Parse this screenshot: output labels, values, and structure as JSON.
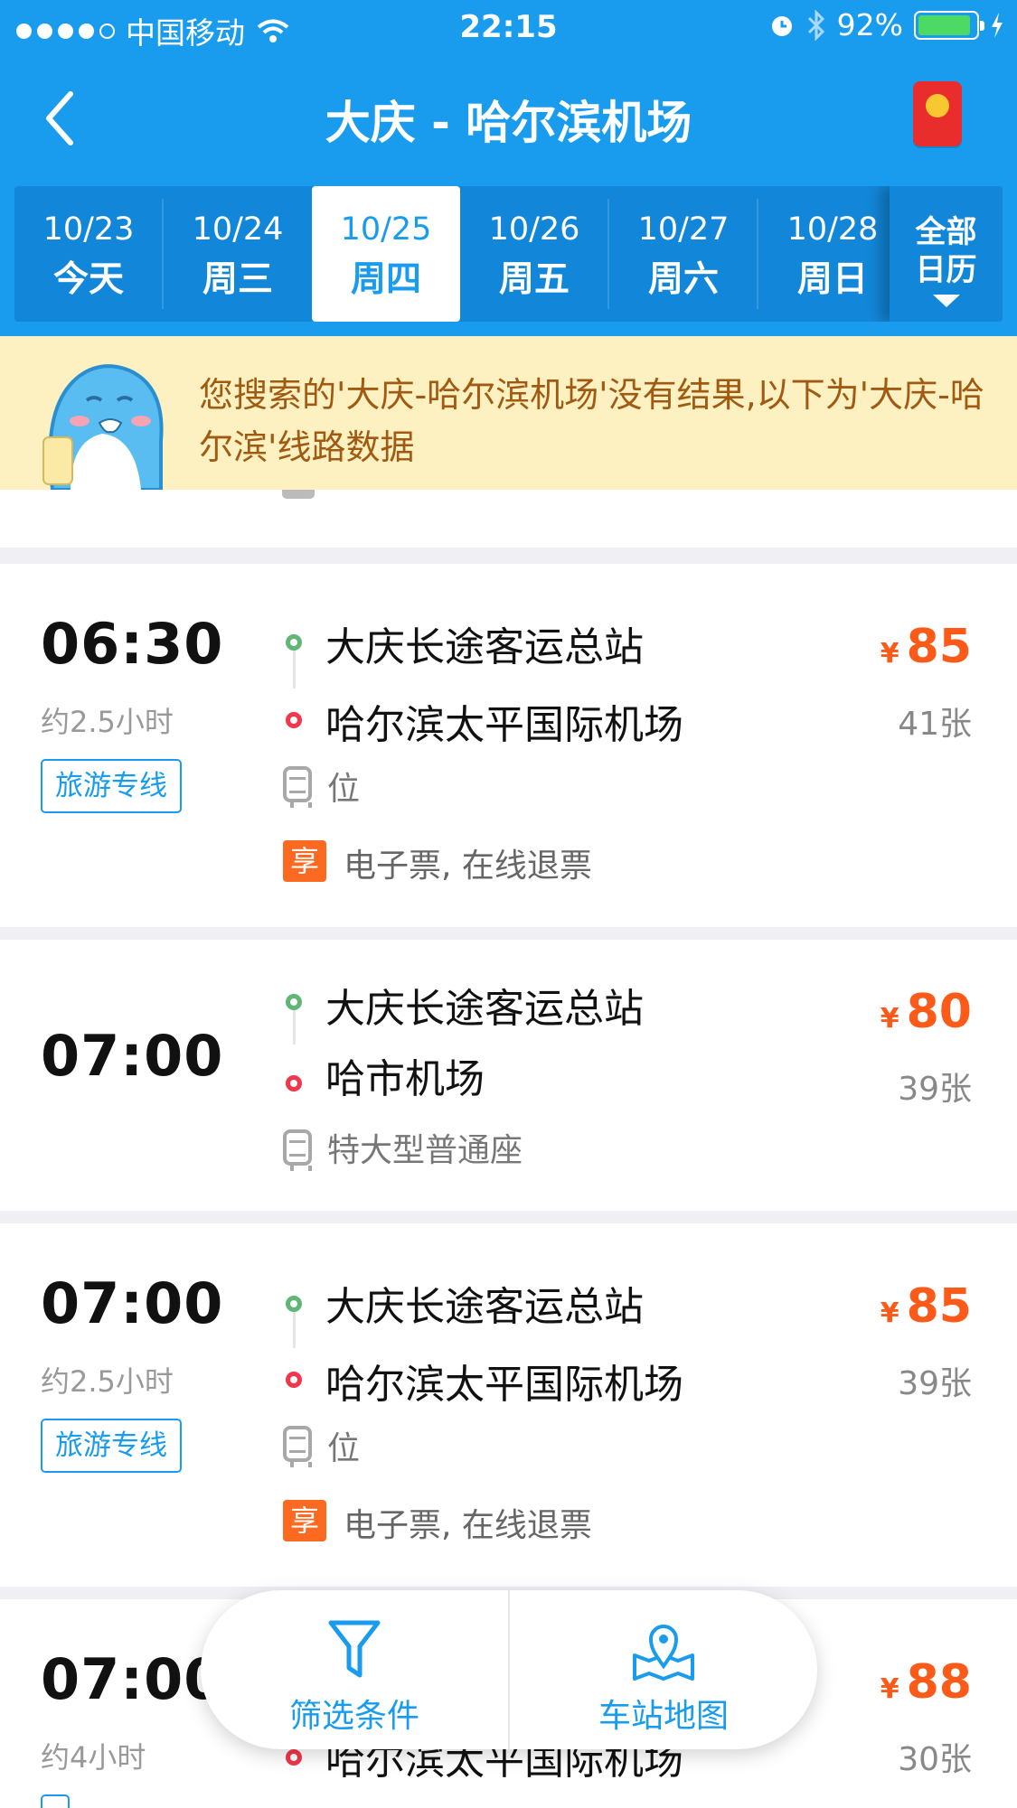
{
  "status_bar": {
    "carrier": "中国移动",
    "time": "22:15",
    "battery": "92%"
  },
  "nav": {
    "title": "大庆 - 哈尔滨机场"
  },
  "dates": [
    {
      "date": "10/23",
      "week": "今天"
    },
    {
      "date": "10/24",
      "week": "周三"
    },
    {
      "date": "10/25",
      "week": "周四"
    },
    {
      "date": "10/26",
      "week": "周五"
    },
    {
      "date": "10/27",
      "week": "周六"
    },
    {
      "date": "10/28",
      "week": "周日"
    }
  ],
  "calendar_button": {
    "line1": "全部",
    "line2": "日历"
  },
  "notice": "您搜索的'大庆-哈尔滨机场'没有结果,以下为'大庆-哈尔滨'线路数据",
  "trips": [
    {
      "time": "06:30",
      "duration": "约2.5小时",
      "tag": "旅游专线",
      "from": "大庆长途客运总站",
      "to": "哈尔滨太平国际机场",
      "seat": "位",
      "perk_badge": "享",
      "perks": "电子票, 在线退票",
      "currency": "¥",
      "price": "85",
      "tickets": "41张"
    },
    {
      "time": "07:00",
      "from": "大庆长途客运总站",
      "to": "哈市机场",
      "seat": "特大型普通座",
      "currency": "¥",
      "price": "80",
      "tickets": "39张"
    },
    {
      "time": "07:00",
      "duration": "约2.5小时",
      "tag": "旅游专线",
      "from": "大庆长途客运总站",
      "to": "哈尔滨太平国际机场",
      "seat": "位",
      "perk_badge": "享",
      "perks": "电子票, 在线退票",
      "currency": "¥",
      "price": "85",
      "tickets": "39张"
    },
    {
      "time": "07:00",
      "duration": "约4小时",
      "to": "哈尔滨太平国际机场",
      "currency": "¥",
      "price": "88",
      "tickets": "30张"
    }
  ],
  "bottom_actions": {
    "filter": "筛选条件",
    "map": "车站地图"
  },
  "colors": {
    "brand_blue": "#1a9cee",
    "price_orange": "#fb5a18",
    "notice_bg": "#fdf1c1"
  }
}
